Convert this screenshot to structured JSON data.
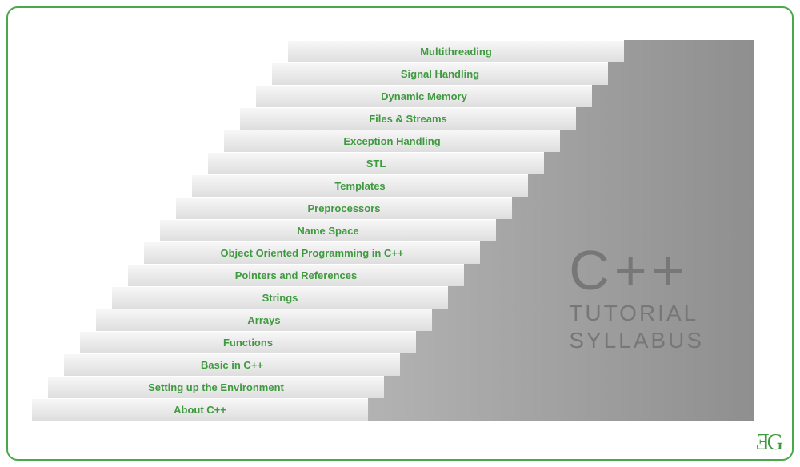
{
  "title": {
    "big": "C++",
    "line1": "TUTORIAL",
    "line2": "SYLLABUS"
  },
  "logo": "ƎG",
  "steps": [
    "About C++",
    "Setting up the Environment",
    "Basic in C++",
    "Functions",
    "Arrays",
    "Strings",
    "Pointers and References",
    "Object Oriented Programming in C++",
    "Name Space",
    "Preprocessors",
    "Templates",
    "STL",
    "Exception Handling",
    "Files & Streams",
    "Dynamic Memory",
    "Signal Handling",
    "Multithreading"
  ],
  "colors": {
    "accent": "#4aa84a",
    "text": "#3f9a3f"
  }
}
